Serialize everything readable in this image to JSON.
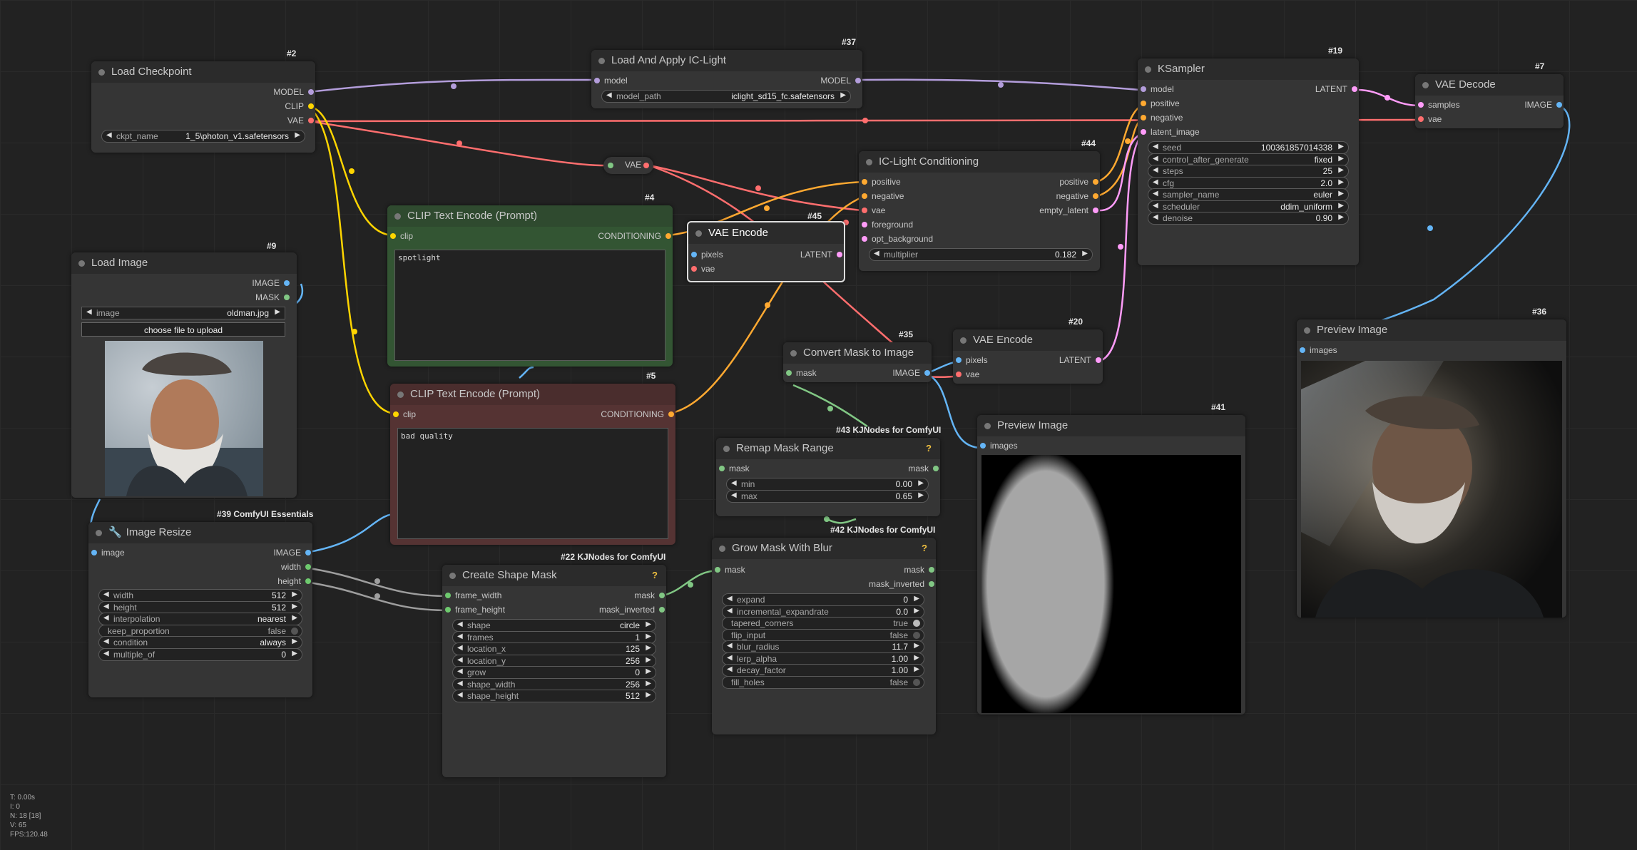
{
  "nodes": {
    "load_checkpoint": {
      "id": "#2",
      "title": "Load Checkpoint",
      "out_model": "MODEL",
      "out_clip": "CLIP",
      "out_vae": "VAE",
      "ckpt_label": "ckpt_name",
      "ckpt_value": "1_5\\photon_v1.safetensors"
    },
    "load_apply_iclight": {
      "id": "#37",
      "title": "Load And Apply IC-Light",
      "in_model": "model",
      "out_model": "MODEL",
      "path_label": "model_path",
      "path_value": "iclight_sd15_fc.safetensors"
    },
    "ksampler": {
      "id": "#19",
      "title": "KSampler",
      "in_model": "model",
      "in_positive": "positive",
      "in_negative": "negative",
      "in_latent": "latent_image",
      "out_latent": "LATENT",
      "widgets": [
        {
          "label": "seed",
          "value": "100361857014338"
        },
        {
          "label": "control_after_generate",
          "value": "fixed"
        },
        {
          "label": "steps",
          "value": "25"
        },
        {
          "label": "cfg",
          "value": "2.0"
        },
        {
          "label": "sampler_name",
          "value": "euler"
        },
        {
          "label": "scheduler",
          "value": "ddim_uniform"
        },
        {
          "label": "denoise",
          "value": "0.90"
        }
      ]
    },
    "vae_decode": {
      "id": "#7",
      "title": "VAE Decode",
      "in_samples": "samples",
      "in_vae": "vae",
      "out_image": "IMAGE"
    },
    "vae_reroute": {
      "label": "VAE"
    },
    "iclight_conditioning": {
      "id": "#44",
      "title": "IC-Light Conditioning",
      "in_positive": "positive",
      "in_negative": "negative",
      "in_vae": "vae",
      "in_foreground": "foreground",
      "in_opt_background": "opt_background",
      "out_positive": "positive",
      "out_negative": "negative",
      "out_empty_latent": "empty_latent",
      "multiplier_label": "multiplier",
      "multiplier_value": "0.182"
    },
    "clip_pos": {
      "id": "#4",
      "title": "CLIP Text Encode (Prompt)",
      "in_clip": "clip",
      "out_cond": "CONDITIONING",
      "text": "spotlight"
    },
    "clip_neg": {
      "id": "#5",
      "title": "CLIP Text Encode (Prompt)",
      "in_clip": "clip",
      "out_cond": "CONDITIONING",
      "text": "bad quality"
    },
    "vae_encode_45": {
      "id": "#45",
      "title": "VAE Encode",
      "in_pixels": "pixels",
      "in_vae": "vae",
      "out_latent": "LATENT"
    },
    "load_image": {
      "id": "#9",
      "title": "Load Image",
      "out_image": "IMAGE",
      "out_mask": "MASK",
      "image_label": "image",
      "image_value": "oldman.jpg",
      "upload_button": "choose file to upload"
    },
    "convert_mask": {
      "id": "#35",
      "title": "Convert Mask to Image",
      "in_mask": "mask",
      "out_image": "IMAGE"
    },
    "vae_encode_20": {
      "id": "#20",
      "title": "VAE Encode",
      "in_pixels": "pixels",
      "in_vae": "vae",
      "out_latent": "LATENT"
    },
    "preview_36": {
      "id": "#36",
      "title": "Preview Image",
      "in_images": "images"
    },
    "preview_41": {
      "id": "#41",
      "title": "Preview Image",
      "in_images": "images"
    },
    "remap_mask": {
      "id": "#43 KJNodes for ComfyUI",
      "title": "Remap Mask Range",
      "in_mask": "mask",
      "out_mask": "mask",
      "widgets": [
        {
          "label": "min",
          "value": "0.00"
        },
        {
          "label": "max",
          "value": "0.65"
        }
      ]
    },
    "grow_mask": {
      "id": "#42 KJNodes for ComfyUI",
      "title": "Grow Mask With Blur",
      "in_mask": "mask",
      "out_mask": "mask",
      "out_mask_inverted": "mask_inverted",
      "widgets": [
        {
          "label": "expand",
          "value": "0"
        },
        {
          "label": "incremental_expandrate",
          "value": "0.0"
        },
        {
          "label": "tapered_corners",
          "value": "true",
          "toggle": true
        },
        {
          "label": "flip_input",
          "value": "false",
          "toggle": true
        },
        {
          "label": "blur_radius",
          "value": "11.7"
        },
        {
          "label": "lerp_alpha",
          "value": "1.00"
        },
        {
          "label": "decay_factor",
          "value": "1.00"
        },
        {
          "label": "fill_holes",
          "value": "false",
          "toggle": true
        }
      ]
    },
    "image_resize": {
      "id": "#39 ComfyUI Essentials",
      "title": "Image Resize",
      "in_image": "image",
      "out_image": "IMAGE",
      "out_width": "width",
      "out_height": "height",
      "widgets": [
        {
          "label": "width",
          "value": "512"
        },
        {
          "label": "height",
          "value": "512"
        },
        {
          "label": "interpolation",
          "value": "nearest"
        },
        {
          "label": "keep_proportion",
          "value": "false",
          "toggle": true
        },
        {
          "label": "condition",
          "value": "always"
        },
        {
          "label": "multiple_of",
          "value": "0"
        }
      ]
    },
    "create_shape_mask": {
      "id": "#22 KJNodes for ComfyUI",
      "title": "Create Shape Mask",
      "in_frame_width": "frame_width",
      "in_frame_height": "frame_height",
      "out_mask": "mask",
      "out_mask_inverted": "mask_inverted",
      "widgets": [
        {
          "label": "shape",
          "value": "circle"
        },
        {
          "label": "frames",
          "value": "1"
        },
        {
          "label": "location_x",
          "value": "125"
        },
        {
          "label": "location_y",
          "value": "256"
        },
        {
          "label": "grow",
          "value": "0"
        },
        {
          "label": "shape_width",
          "value": "256"
        },
        {
          "label": "shape_height",
          "value": "512"
        }
      ]
    }
  },
  "stats": [
    "T: 0.00s",
    "I: 0",
    "N: 18 [18]",
    "V: 65",
    "FPS:120.48"
  ],
  "colors": {
    "model": "#b39ddb",
    "clip": "#ffd500",
    "vae": "#ff6e6e",
    "conditioning": "#ffa931",
    "latent": "#ff9cf9",
    "image": "#64b5f6",
    "mask": "#81c784",
    "int": "#6ec96e"
  }
}
